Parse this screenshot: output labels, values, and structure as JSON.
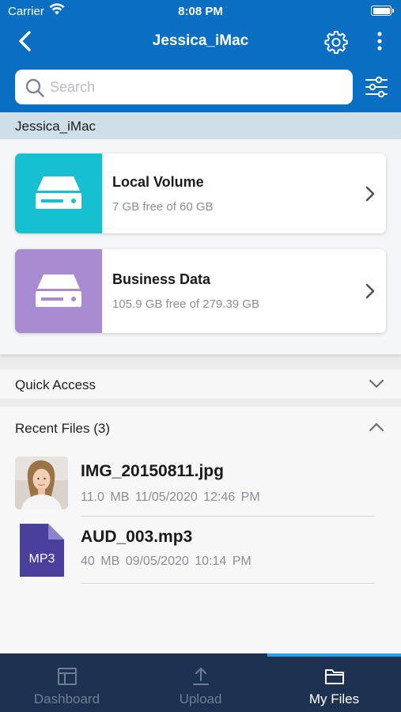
{
  "status_bar": {
    "carrier": "Carrier",
    "time": "8:08 PM"
  },
  "nav": {
    "title": "Jessica_iMac"
  },
  "search": {
    "placeholder": "Search"
  },
  "breadcrumb": {
    "label": "Jessica_iMac"
  },
  "volumes": [
    {
      "name": "Local Volume",
      "free": "7 GB free of 60 GB",
      "color": "#17c0d0"
    },
    {
      "name": "Business Data",
      "free": "105.9 GB free of 279.39 GB",
      "color": "#a88bd0"
    }
  ],
  "quick_access": {
    "label": "Quick Access"
  },
  "recent_files": {
    "label": "Recent Files (3)",
    "items": [
      {
        "name": "IMG_20150811.jpg",
        "meta": "11.0 MB  11/05/2020  12:46 PM",
        "type_icon": "image-thumbnail"
      },
      {
        "name": "AUD_003.mp3",
        "meta": "40 MB  09/05/2020  10:14 PM",
        "type_icon": "mp3-file-icon",
        "badge": "MP3"
      }
    ]
  },
  "tabbar": {
    "tabs": [
      {
        "label": "Dashboard",
        "icon": "dashboard-icon",
        "active": false
      },
      {
        "label": "Upload",
        "icon": "upload-icon",
        "active": false
      },
      {
        "label": "My Files",
        "icon": "folder-icon",
        "active": true
      }
    ]
  },
  "colors": {
    "brand": "#0a6fc2",
    "tabbar": "#1d3251",
    "active_indicator": "#2fa0e8"
  }
}
